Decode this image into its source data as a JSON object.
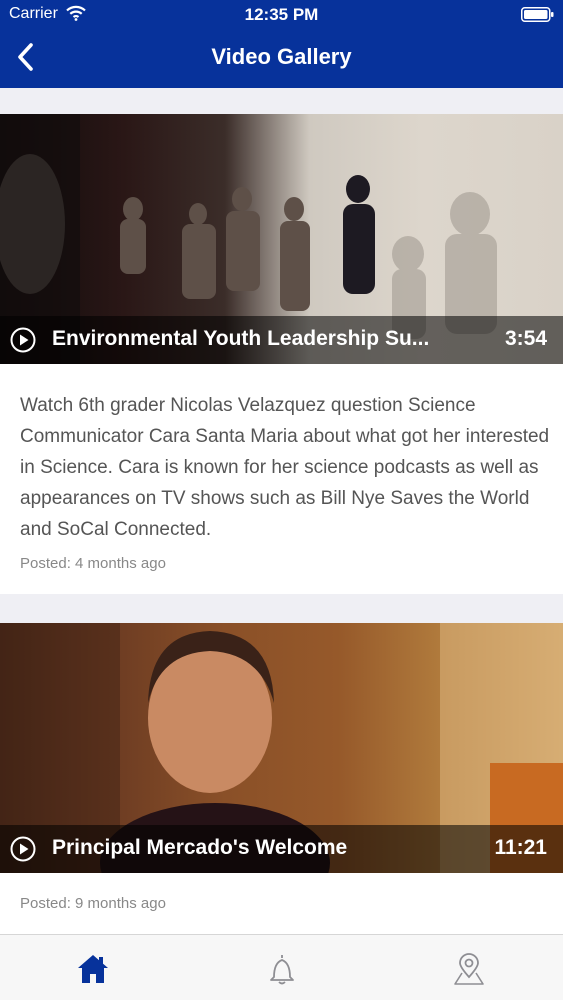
{
  "status_bar": {
    "carrier": "Carrier",
    "time": "12:35 PM"
  },
  "nav": {
    "title": "Video Gallery",
    "back_icon": "chevron-left-icon"
  },
  "videos": [
    {
      "title": "Environmental Youth Leadership Su...",
      "duration": "3:54",
      "description": "Watch 6th grader Nicolas Velazquez question Science Communicator Cara Santa Maria about what got her interested in Science. Cara is known for her science podcasts as well as appearances on TV shows such as Bill Nye Saves the World and SoCal Connected.",
      "posted": "Posted: 4 months ago"
    },
    {
      "title": "Principal Mercado's Welcome",
      "duration": "11:21",
      "posted": "Posted: 9 months ago"
    }
  ],
  "tab_bar": {
    "items": [
      {
        "icon": "home-icon",
        "active": true
      },
      {
        "icon": "bell-icon",
        "active": false
      },
      {
        "icon": "map-pin-icon",
        "active": false
      }
    ]
  },
  "colors": {
    "brand": "#07329b",
    "tab_inactive": "#8e8e93",
    "text_secondary": "#555555"
  }
}
